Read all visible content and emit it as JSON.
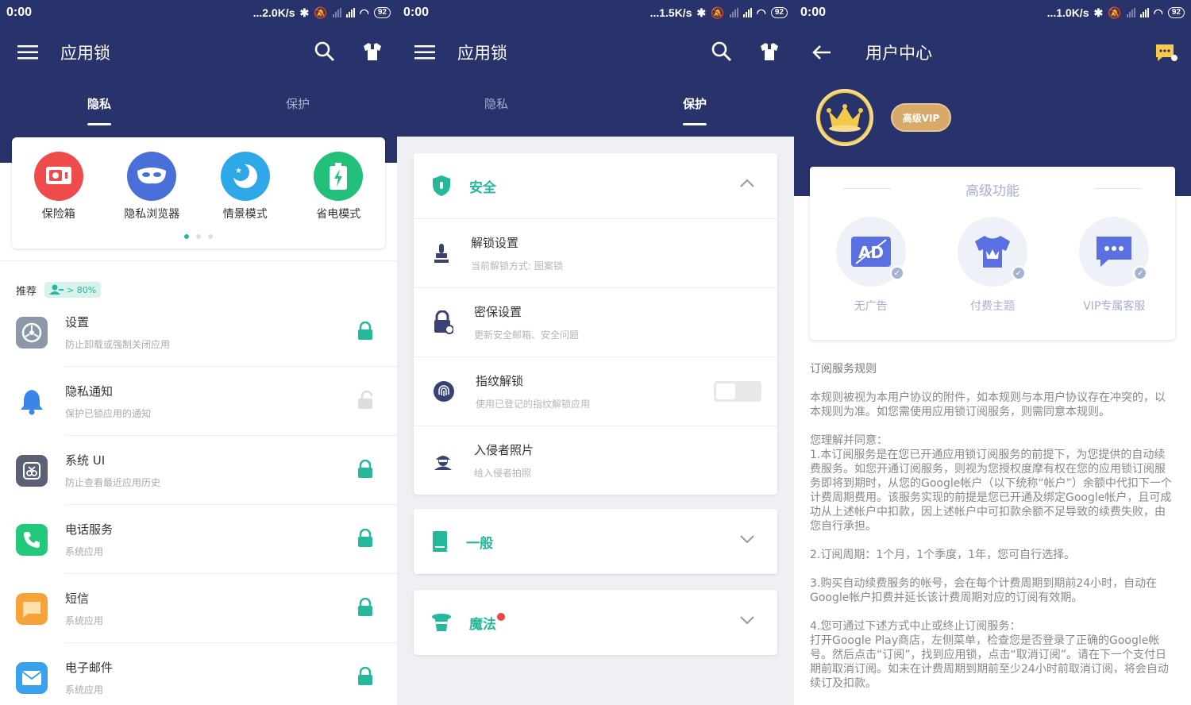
{
  "status": [
    {
      "time": "0:00",
      "speed": "...2.0K/s",
      "battery": "92"
    },
    {
      "time": "0:00",
      "speed": "...1.5K/s",
      "battery": "92"
    },
    {
      "time": "0:00",
      "speed": "...1.0K/s",
      "battery": "92"
    }
  ],
  "panel1": {
    "title": "应用锁",
    "tabs": [
      "隐私",
      "保护"
    ],
    "features": [
      {
        "label": "保险箱",
        "color": "#ef4b4b"
      },
      {
        "label": "隐私浏览器",
        "color": "#4a6fd8"
      },
      {
        "label": "情景模式",
        "color": "#2ea8e8"
      },
      {
        "label": "省电模式",
        "color": "#22c07a"
      }
    ],
    "recommend": "推荐",
    "badge": "> 80%",
    "apps": [
      {
        "name": "设置",
        "sub": "防止卸载或强制关闭应用",
        "locked": true
      },
      {
        "name": "隐私通知",
        "sub": "保护已锁应用的通知",
        "locked": false
      },
      {
        "name": "系统 UI",
        "sub": "防止查看最近应用历史",
        "locked": true
      },
      {
        "name": "电话服务",
        "sub": "系统应用",
        "locked": true
      },
      {
        "name": "短信",
        "sub": "系统应用",
        "locked": true
      },
      {
        "name": "电子邮件",
        "sub": "系统应用",
        "locked": true
      }
    ]
  },
  "panel2": {
    "title": "应用锁",
    "tabs": [
      "隐私",
      "保护"
    ],
    "security": {
      "title": "安全",
      "rows": [
        {
          "name": "解锁设置",
          "sub": "当前解锁方式: 图案锁"
        },
        {
          "name": "密保设置",
          "sub": "更新安全邮箱、安全问题"
        },
        {
          "name": "指纹解锁",
          "sub": "使用已登记的指纹解锁应用"
        },
        {
          "name": "入侵者照片",
          "sub": "给入侵者拍照"
        }
      ]
    },
    "general": "一般",
    "magic": "魔法"
  },
  "panel3": {
    "title": "用户中心",
    "vip_chip": "高级VIP",
    "premium_title": "高级功能",
    "features": [
      "无广告",
      "付费主题",
      "VIP专属客服"
    ],
    "rules_title": "订阅服务规则",
    "rules": [
      "本规则被视为本用户协议的附件，如本规则与本用户协议存在冲突的，以本规则为准。如您需使用应用锁订阅服务，则需同意本规则。",
      "您理解并同意：\n1.本订阅服务是在您已开通应用锁订阅服务的前提下，为您提供的自动续费服务。如您开通订阅服务，则视为您授权度摩有权在您的应用锁订阅服务即将到期时，从您的Google帐户（以下统称“帐户”）余额中代扣下一个计费周期费用。该服务实现的前提是您已开通及绑定Google帐户，且可成功从上述帐户中扣款，因上述帐户中可扣款余额不足导致的续费失败，由您自行承担。",
      "2.订阅周期：1个月，1个季度，1年，您可自行选择。",
      "3.购买自动续费服务的帐号，会在每个计费周期到期前24小时，自动在Google帐户扣费并延长该计费周期对应的订阅有效期。",
      "4.您可通过下述方式中止或终止订阅服务：\n打开Google Play商店，左侧菜单，检查您是否登录了正确的Google帐号。然后点击“订阅”，找到应用锁，点击“取消订阅”。请在下一个支付日期前取消订阅。如未在计费周期到期前至少24小时前取消订阅，将会自动续订及扣款。"
    ]
  },
  "colors": {
    "navy": "#27336a",
    "accent": "#25b89c"
  }
}
